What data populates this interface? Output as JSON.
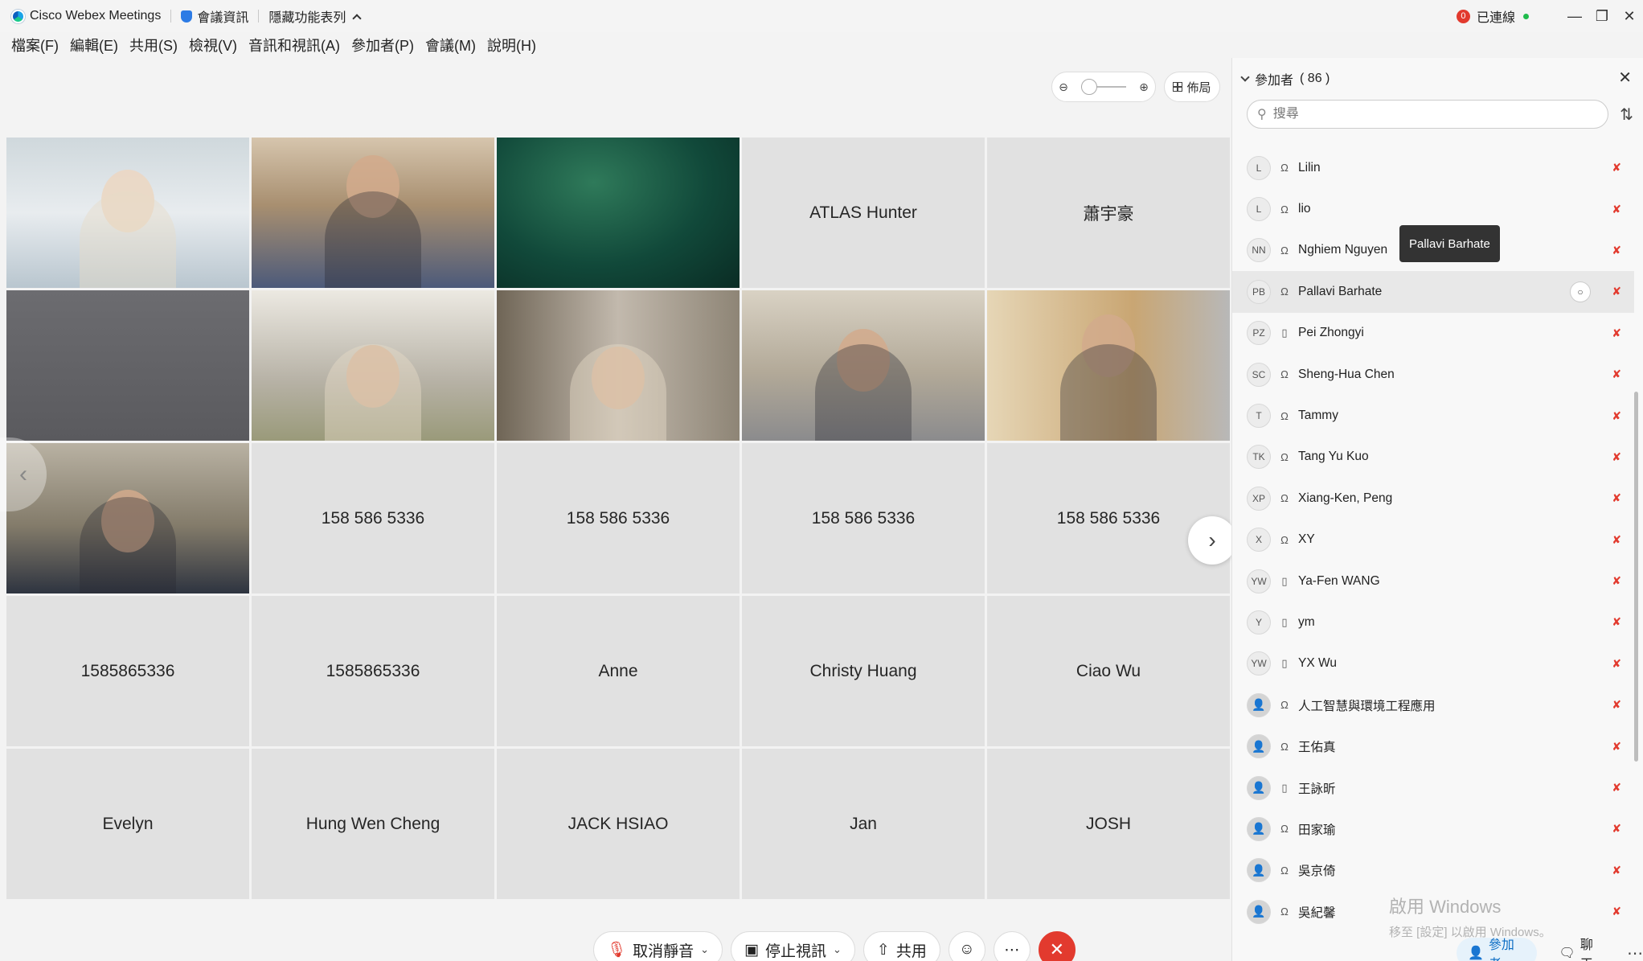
{
  "titlebar": {
    "app_name": "Cisco Webex Meetings",
    "meeting_info": "會議資訊",
    "hide_menu": "隱藏功能表列",
    "alert_count": "0",
    "status": "已連線"
  },
  "menubar": [
    "檔案(F)",
    "編輯(E)",
    "共用(S)",
    "檢視(V)",
    "音訊和視訊(A)",
    "參加者(P)",
    "會議(M)",
    "說明(H)"
  ],
  "stage": {
    "layout_label": "佈局"
  },
  "tiles": [
    {
      "type": "video"
    },
    {
      "type": "video"
    },
    {
      "type": "video"
    },
    {
      "type": "name",
      "label": "ATLAS Hunter"
    },
    {
      "type": "name",
      "label": "蕭宇豪"
    },
    {
      "type": "video"
    },
    {
      "type": "video"
    },
    {
      "type": "video"
    },
    {
      "type": "video"
    },
    {
      "type": "video"
    },
    {
      "type": "video"
    },
    {
      "type": "name",
      "label": "158 586 5336"
    },
    {
      "type": "name",
      "label": "158 586 5336"
    },
    {
      "type": "name",
      "label": "158 586 5336"
    },
    {
      "type": "name",
      "label": "158 586 5336"
    },
    {
      "type": "name",
      "label": "1585865336"
    },
    {
      "type": "name",
      "label": "1585865336"
    },
    {
      "type": "name",
      "label": "Anne"
    },
    {
      "type": "name",
      "label": "Christy Huang"
    },
    {
      "type": "name",
      "label": "Ciao Wu"
    },
    {
      "type": "name",
      "label": "Evelyn"
    },
    {
      "type": "name",
      "label": "Hung Wen Cheng"
    },
    {
      "type": "name",
      "label": "JACK HSIAO"
    },
    {
      "type": "name",
      "label": "Jan"
    },
    {
      "type": "name",
      "label": "JOSH"
    }
  ],
  "controls": {
    "unmute": "取消靜音",
    "stop_video": "停止視訊",
    "share": "共用"
  },
  "panel": {
    "title": "參加者",
    "count": "( 86 )",
    "search_placeholder": "搜尋",
    "tooltip": "Pallavi Barhate",
    "participants": [
      {
        "initials": "L",
        "name": "Lilin",
        "device": "headset"
      },
      {
        "initials": "L",
        "name": "lio",
        "device": "headset"
      },
      {
        "initials": "NN",
        "name": "Nghiem Nguyen",
        "device": "headset"
      },
      {
        "initials": "PB",
        "name": "Pallavi Barhate",
        "device": "headset"
      },
      {
        "initials": "PZ",
        "name": "Pei Zhongyi",
        "device": "phone"
      },
      {
        "initials": "SC",
        "name": "Sheng-Hua Chen",
        "device": "headset"
      },
      {
        "initials": "T",
        "name": "Tammy",
        "device": "headset"
      },
      {
        "initials": "TK",
        "name": "Tang Yu Kuo",
        "device": "headset"
      },
      {
        "initials": "XP",
        "name": "Xiang-Ken, Peng",
        "device": "headset"
      },
      {
        "initials": "X",
        "name": "XY",
        "device": "headset"
      },
      {
        "initials": "YW",
        "name": "Ya-Fen WANG",
        "device": "phone"
      },
      {
        "initials": "Y",
        "name": "ym",
        "device": "phone"
      },
      {
        "initials": "YW",
        "name": "YX Wu",
        "device": "phone"
      },
      {
        "initials": "",
        "name": "人工智慧與環境工程應用",
        "device": "headset"
      },
      {
        "initials": "",
        "name": "王佑真",
        "device": "headset"
      },
      {
        "initials": "",
        "name": "王詠昕",
        "device": "phone"
      },
      {
        "initials": "",
        "name": "田家瑜",
        "device": "headset"
      },
      {
        "initials": "",
        "name": "吳京倚",
        "device": "headset"
      },
      {
        "initials": "",
        "name": "吳紀馨",
        "device": "headset"
      }
    ],
    "tabs": {
      "participants": "參加者",
      "chat": "聊天"
    }
  },
  "watermark": {
    "line1": "啟用 Windows",
    "line2": "移至 [設定] 以啟用 Windows。"
  }
}
